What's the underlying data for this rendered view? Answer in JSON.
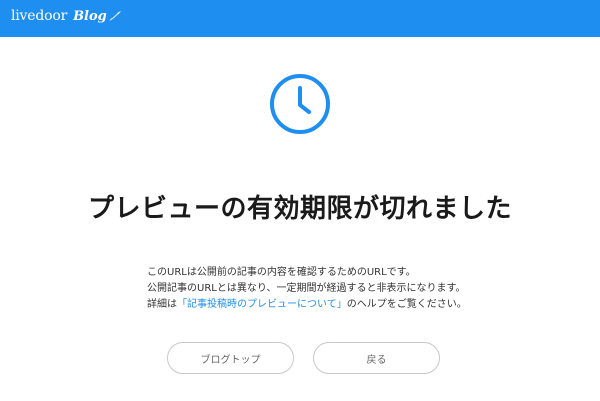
{
  "header": {
    "logo_main": "livedoor",
    "logo_blog": "Blog",
    "brand_color": "#1e8ff0"
  },
  "icon": {
    "name": "clock-icon",
    "color": "#1e8ff0"
  },
  "main": {
    "title": "プレビューの有効期限が切れました",
    "line1": "このURLは公開前の記事の内容を確認するためのURLです。",
    "line2": "公開記事のURLとは異なり、一定期間が経過すると非表示になります。",
    "line3_prefix": "詳細は",
    "line3_link": "「記事投稿時のプレビューについて」",
    "line3_suffix": "のヘルプをご覧ください。"
  },
  "buttons": {
    "blog_top": "ブログトップ",
    "back": "戻る"
  }
}
